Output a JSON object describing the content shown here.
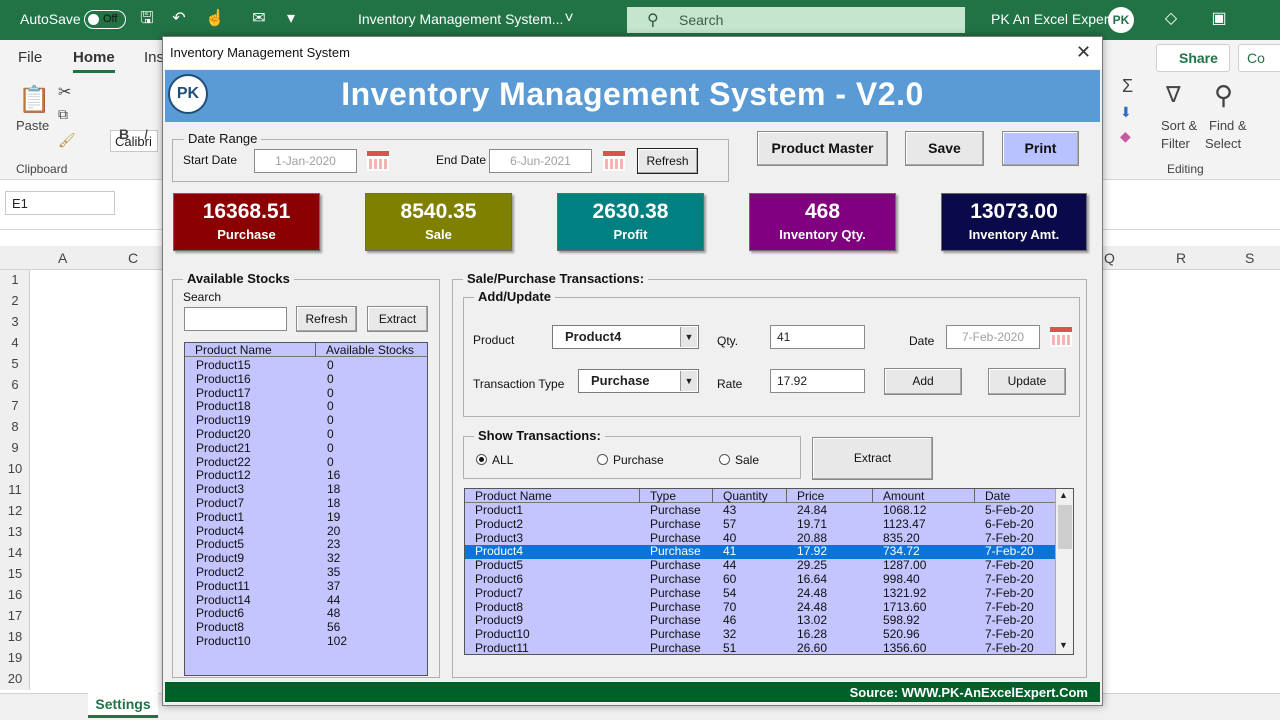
{
  "excel": {
    "autosave_label": "AutoSave",
    "autosave_state": "Off",
    "doc_title": "Inventory Management System...",
    "search_placeholder": "Search",
    "user_name": "PK An Excel Expert",
    "avatar_initials": "PK",
    "tabs": [
      "File",
      "Home",
      "Ins"
    ],
    "share_label": "Share",
    "comments_label": "Co",
    "font_name": "Calibri",
    "clipboard_label": "Clipboard",
    "paste_label": "Paste",
    "bold_label": "B",
    "italic_label": "I",
    "sort_filter_label": "Sort &",
    "sort_filter_label2": "Filter",
    "find_select_label": "Find &",
    "find_select_label2": "Select",
    "editing_label": "Editing",
    "name_box": "E1",
    "columns_left": [
      "A",
      "C"
    ],
    "columns_right": [
      "Q",
      "R",
      "S"
    ],
    "rows": [
      "1",
      "2",
      "3",
      "4",
      "5",
      "6",
      "7",
      "8",
      "9",
      "10",
      "11",
      "12",
      "13",
      "14",
      "15",
      "16",
      "17",
      "18",
      "19",
      "20"
    ],
    "sheet_tab": "Settings"
  },
  "form": {
    "window_title": "Inventory Management System",
    "banner_title": "Inventory Management System - V2.0",
    "logo_text": "PK",
    "date_range": {
      "label": "Date Range",
      "start_label": "Start Date",
      "start_value": "1-Jan-2020",
      "end_label": "End Date",
      "end_value": "6-Jun-2021",
      "refresh_label": "Refresh"
    },
    "buttons": {
      "product_master": "Product Master",
      "save": "Save",
      "print": "Print"
    },
    "kpis": [
      {
        "value": "16368.51",
        "label": "Purchase",
        "color": "#8b0000"
      },
      {
        "value": "8540.35",
        "label": "Sale",
        "color": "#808000"
      },
      {
        "value": "2630.38",
        "label": "Profit",
        "color": "#008080"
      },
      {
        "value": "468",
        "label": "Inventory Qty.",
        "color": "#800080"
      },
      {
        "value": "13073.00",
        "label": "Inventory Amt.",
        "color": "#0a0a4a"
      }
    ],
    "stocks": {
      "title": "Available Stocks",
      "search_label": "Search",
      "search_value": "",
      "refresh_label": "Refresh",
      "extract_label": "Extract",
      "headers": [
        "Product Name",
        "Available Stocks"
      ],
      "rows": [
        [
          "Product15",
          "0"
        ],
        [
          "Product16",
          "0"
        ],
        [
          "Product17",
          "0"
        ],
        [
          "Product18",
          "0"
        ],
        [
          "Product19",
          "0"
        ],
        [
          "Product20",
          "0"
        ],
        [
          "Product21",
          "0"
        ],
        [
          "Product22",
          "0"
        ],
        [
          "Product12",
          "16"
        ],
        [
          "Product3",
          "18"
        ],
        [
          "Product7",
          "18"
        ],
        [
          "Product1",
          "19"
        ],
        [
          "Product4",
          "20"
        ],
        [
          "Product5",
          "23"
        ],
        [
          "Product9",
          "32"
        ],
        [
          "Product2",
          "35"
        ],
        [
          "Product11",
          "37"
        ],
        [
          "Product14",
          "44"
        ],
        [
          "Product6",
          "48"
        ],
        [
          "Product8",
          "56"
        ],
        [
          "Product10",
          "102"
        ]
      ]
    },
    "transactions": {
      "title": "Sale/Purchase Transactions:",
      "add_update_title": "Add/Update",
      "product_label": "Product",
      "product_value": "Product4",
      "qty_label": "Qty.",
      "qty_value": "41",
      "date_label": "Date",
      "date_value": "7-Feb-2020",
      "type_label": "Transaction Type",
      "type_value": "Purchase",
      "rate_label": "Rate",
      "rate_value": "17.92",
      "add_label": "Add",
      "update_label": "Update",
      "show_title": "Show Transactions:",
      "radio_all": "ALL",
      "radio_purchase": "Purchase",
      "radio_sale": "Sale",
      "extract_label": "Extract",
      "headers": [
        "Product Name",
        "Type",
        "Quantity",
        "Price",
        "Amount",
        "Date"
      ],
      "selected_row": 3,
      "rows": [
        [
          "Product1",
          "Purchase",
          "43",
          "24.84",
          "1068.12",
          "5-Feb-20"
        ],
        [
          "Product2",
          "Purchase",
          "57",
          "19.71",
          "1123.47",
          "6-Feb-20"
        ],
        [
          "Product3",
          "Purchase",
          "40",
          "20.88",
          "835.20",
          "7-Feb-20"
        ],
        [
          "Product4",
          "Purchase",
          "41",
          "17.92",
          "734.72",
          "7-Feb-20"
        ],
        [
          "Product5",
          "Purchase",
          "44",
          "29.25",
          "1287.00",
          "7-Feb-20"
        ],
        [
          "Product6",
          "Purchase",
          "60",
          "16.64",
          "998.40",
          "7-Feb-20"
        ],
        [
          "Product7",
          "Purchase",
          "54",
          "24.48",
          "1321.92",
          "7-Feb-20"
        ],
        [
          "Product8",
          "Purchase",
          "70",
          "24.48",
          "1713.60",
          "7-Feb-20"
        ],
        [
          "Product9",
          "Purchase",
          "46",
          "13.02",
          "598.92",
          "7-Feb-20"
        ],
        [
          "Product10",
          "Purchase",
          "32",
          "16.28",
          "520.96",
          "7-Feb-20"
        ],
        [
          "Product11",
          "Purchase",
          "51",
          "26.60",
          "1356.60",
          "7-Feb-20"
        ]
      ]
    },
    "footer": "Source: WWW.PK-AnExcelExpert.Com"
  }
}
